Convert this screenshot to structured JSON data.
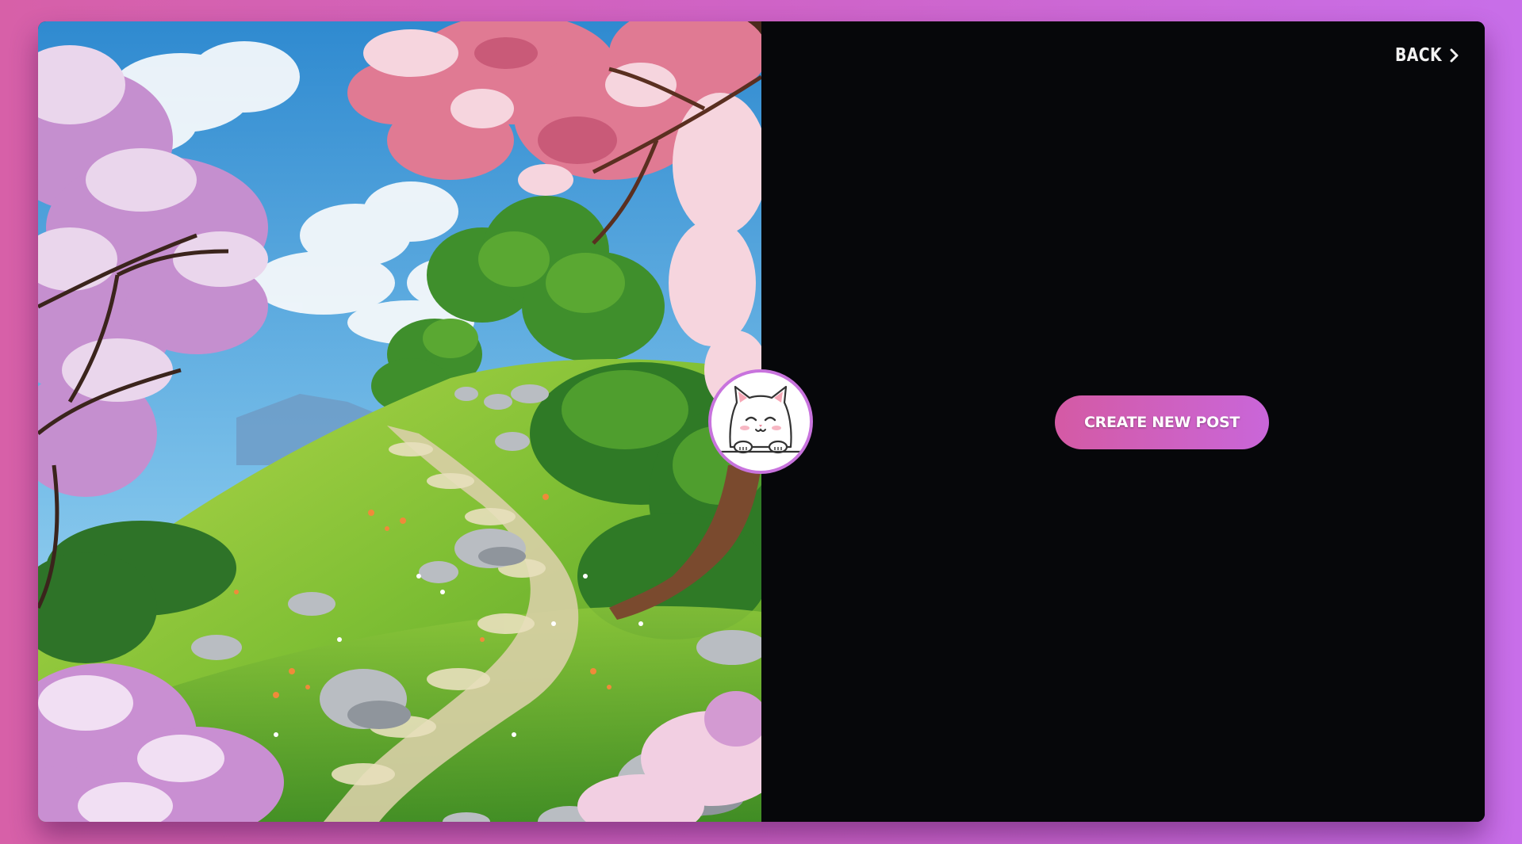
{
  "header": {
    "back_label": "BACK"
  },
  "main": {
    "create_button_label": "CREATE NEW POST"
  },
  "icons": {
    "back": "chevron-right-icon",
    "avatar": "cat-avatar-icon"
  },
  "colors": {
    "background_gradient_start": "#d760a8",
    "background_gradient_end": "#c86ee9",
    "panel_background": "#06070a",
    "button_gradient_start": "#d45aa4",
    "button_gradient_end": "#c966d9",
    "avatar_border": "#c873dd"
  }
}
